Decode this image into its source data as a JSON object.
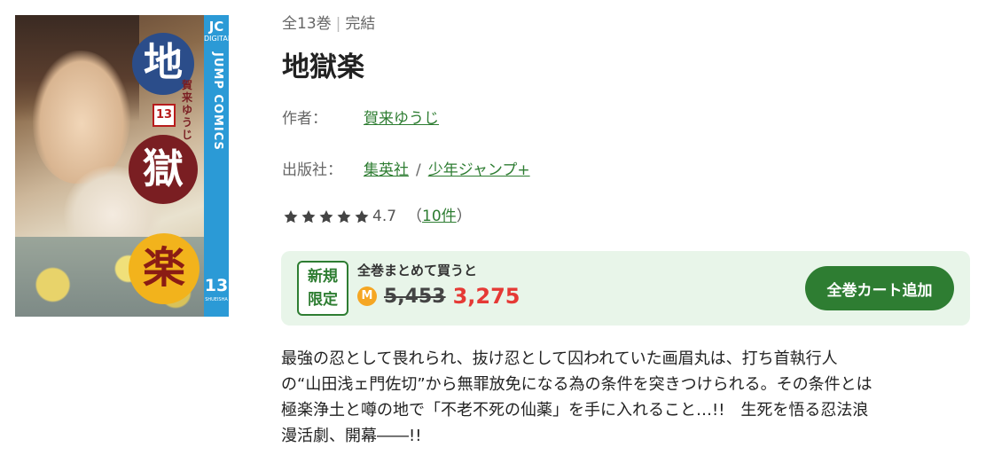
{
  "cover": {
    "kanji": [
      "地",
      "獄",
      "楽"
    ],
    "volume_number": "13",
    "author_vertical": "賀来ゆうじ",
    "spine_brand": "JC",
    "spine_brand_sub": "DIGITAL",
    "spine_series": "JUMP COMICS",
    "spine_number": "13",
    "spine_publisher": "SHUEISHA"
  },
  "volume_info": {
    "count": "全13巻",
    "status": "完結"
  },
  "title": "地獄楽",
  "author": {
    "label": "作者：",
    "name": "賀来ゆうじ"
  },
  "publisher": {
    "label": "出版社：",
    "name": "集英社",
    "label_brand": "少年ジャンプ+"
  },
  "rating": {
    "stars": 5,
    "score": "4.7",
    "open_paren": "（",
    "count": "10件",
    "close_paren": "）",
    "star_color": "#444444"
  },
  "promo": {
    "badge_line1": "新規",
    "badge_line2": "限定",
    "bulk_label": "全巻まとめて買うと",
    "coin_icon": "M",
    "original_price": "5,453",
    "sale_price": "3,275",
    "cart_button": "全巻カート追加",
    "colors": {
      "accent": "#2e7d32",
      "sale": "#e53935",
      "bg": "#e8f5e9"
    }
  },
  "description": [
    "最強の忍として畏れられ、抜け忍として囚われていた画眉丸は、打ち首執行人",
    "の“山田浅ェ門佐切”から無罪放免になる為の条件を突きつけられる。その条件とは",
    "極楽浄土と噂の地で「不老不死の仙薬」を手に入れること…!!　生死を悟る忍法浪",
    "漫活劇、開幕――!!"
  ]
}
